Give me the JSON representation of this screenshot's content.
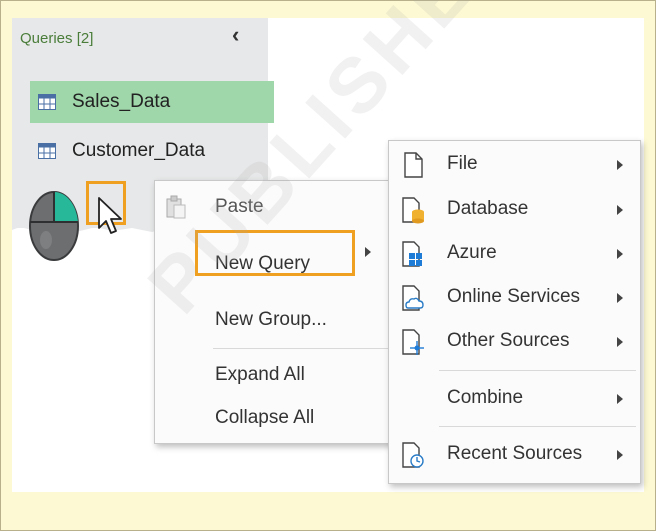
{
  "queries_pane": {
    "header": "Queries [2]",
    "items": [
      {
        "label": "Sales_Data",
        "selected": true
      },
      {
        "label": "Customer_Data",
        "selected": false
      }
    ]
  },
  "context_menu": {
    "paste": "Paste",
    "new_query": "New Query",
    "new_group": "New Group...",
    "expand_all": "Expand All",
    "collapse_all": "Collapse All"
  },
  "submenu": {
    "file": "File",
    "database": "Database",
    "azure": "Azure",
    "online_services": "Online Services",
    "other_sources": "Other Sources",
    "combine": "Combine",
    "recent_sources": "Recent Sources"
  },
  "watermark": "PUBLISHED",
  "colors": {
    "highlight": "#f0a020",
    "selected_row": "#9fd6aa",
    "page_bg": "#fdf9d3"
  }
}
